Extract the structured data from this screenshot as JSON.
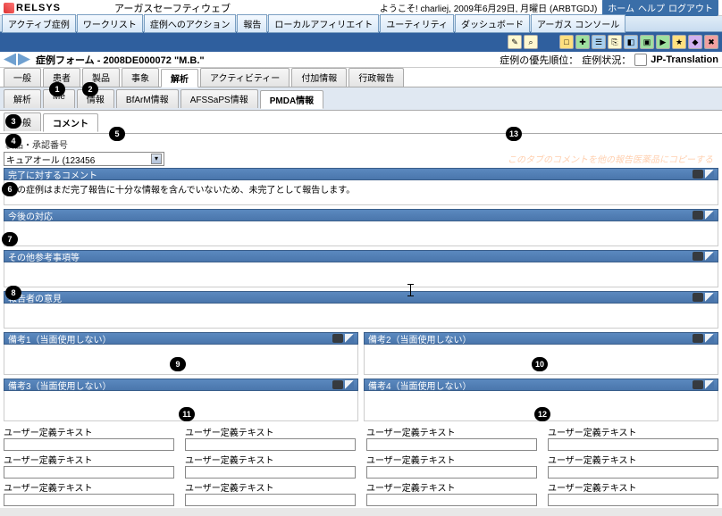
{
  "logo_text": "RELSYS",
  "product_title": "アーガスセーフティウェブ",
  "welcome": "ようこそ! charliej, 2009年6月29日, 月曜日 (ARBTGDJ)",
  "top_links": [
    "ホーム",
    "ヘルプ",
    "ログアウト"
  ],
  "menubar": [
    "アクティブ症例",
    "ワークリスト",
    "症例へのアクション",
    "報告",
    "ローカルアフィリエイト",
    "ユーティリティ",
    "ダッシュボード",
    "アーガス コンソール"
  ],
  "form_title": "症例フォーム - 2008DE000072 \"M.B.\"",
  "case_priority_label": "症例の優先順位：",
  "case_state_label": "症例状況：",
  "case_state_value": "JP-Translation",
  "tabs1": [
    "一般",
    "患者",
    "製品",
    "事象",
    "解析",
    "アクティビティー",
    "付加情報",
    "行政報告"
  ],
  "tabs1_active_index": 4,
  "tabs2": [
    "解析",
    "Me",
    "情報",
    "BfArM情報",
    "AFSSaPS情報",
    "PMDA情報"
  ],
  "tabs2_active_index": 5,
  "tabs3": [
    "一般",
    "コメント"
  ],
  "tabs3_active_index": 1,
  "product_label": "製品・承認番号",
  "product_value": "キュアオール (123456",
  "sections": {
    "comment": {
      "title": "完了に対するコメント",
      "body": "この症例はまだ完了報告に十分な情報を含んでいないため、未完了として報告します。",
      "hint": "このタブのコメントを他の報告医薬品にコピーする"
    },
    "future": {
      "title": "今後の対応"
    },
    "other": {
      "title": "その他参考事項等"
    },
    "reporter": {
      "title": "報告者の意見"
    },
    "biko1": {
      "title": "備考1（当面使用しない）"
    },
    "biko2": {
      "title": "備考2（当面使用しない）"
    },
    "biko3": {
      "title": "備考3（当面使用しない）"
    },
    "biko4": {
      "title": "備考4（当面使用しない）"
    }
  },
  "user_text_label": "ユーザー定義テキスト",
  "callouts": {
    "1": "1",
    "2": "2",
    "3": "3",
    "4": "4",
    "5": "5",
    "6": "6",
    "7": "7",
    "8": "8",
    "9": "9",
    "10": "10",
    "11": "11",
    "12": "12",
    "13": "13"
  }
}
